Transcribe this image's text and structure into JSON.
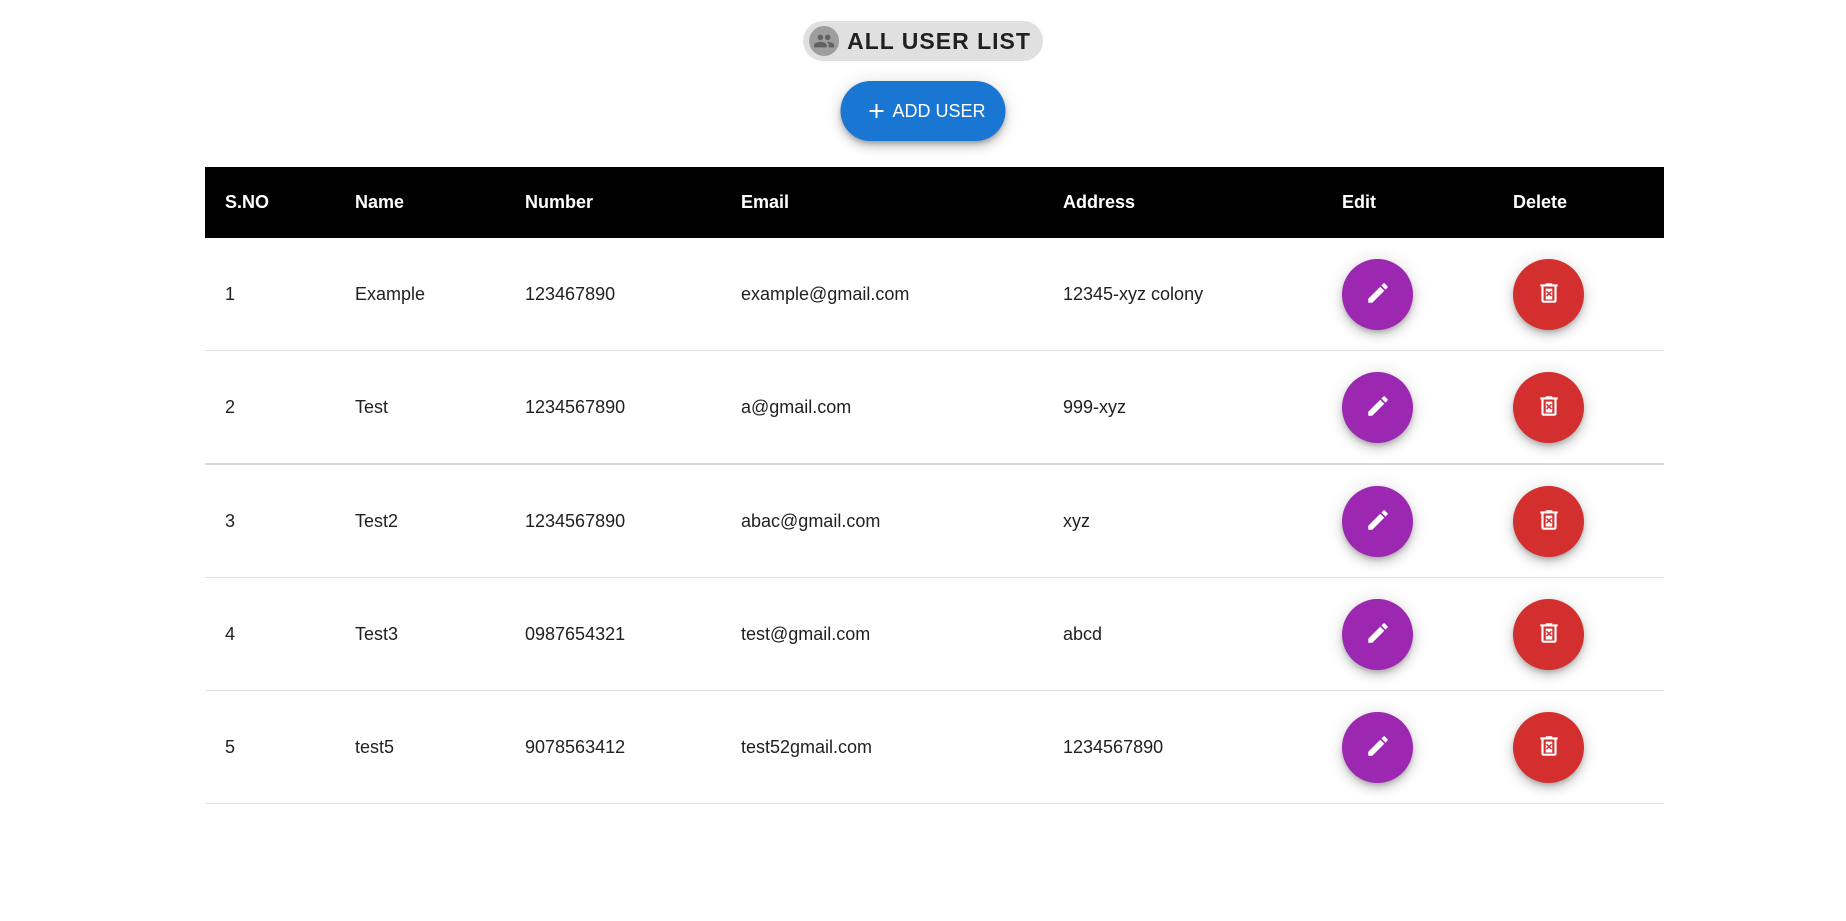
{
  "header": {
    "title": "ALL USER LIST",
    "icon": "people-icon"
  },
  "toolbar": {
    "add_label": "ADD USER",
    "add_icon": "plus-icon"
  },
  "colors": {
    "header_bg": "#000000",
    "add_button": "#1976d2",
    "edit_button": "#9c27b0",
    "delete_button": "#d32f2f",
    "title_chip": "#e0e0e0"
  },
  "table": {
    "columns": [
      "S.NO",
      "Name",
      "Number",
      "Email",
      "Address",
      "Edit",
      "Delete"
    ],
    "rows": [
      {
        "sno": "1",
        "name": "Example",
        "number": "123467890",
        "email": "example@gmail.com",
        "address": "12345-xyz colony"
      },
      {
        "sno": "2",
        "name": "Test",
        "number": "1234567890",
        "email": "a@gmail.com",
        "address": "999-xyz"
      },
      {
        "sno": "3",
        "name": "Test2",
        "number": "1234567890",
        "email": "abac@gmail.com",
        "address": "xyz"
      },
      {
        "sno": "4",
        "name": "Test3",
        "number": "0987654321",
        "email": "test@gmail.com",
        "address": "abcd"
      },
      {
        "sno": "5",
        "name": "test5",
        "number": "9078563412",
        "email": "test52gmail.com",
        "address": "1234567890"
      }
    ],
    "row_actions": {
      "edit_icon": "pencil-icon",
      "delete_icon": "trash-icon"
    }
  }
}
